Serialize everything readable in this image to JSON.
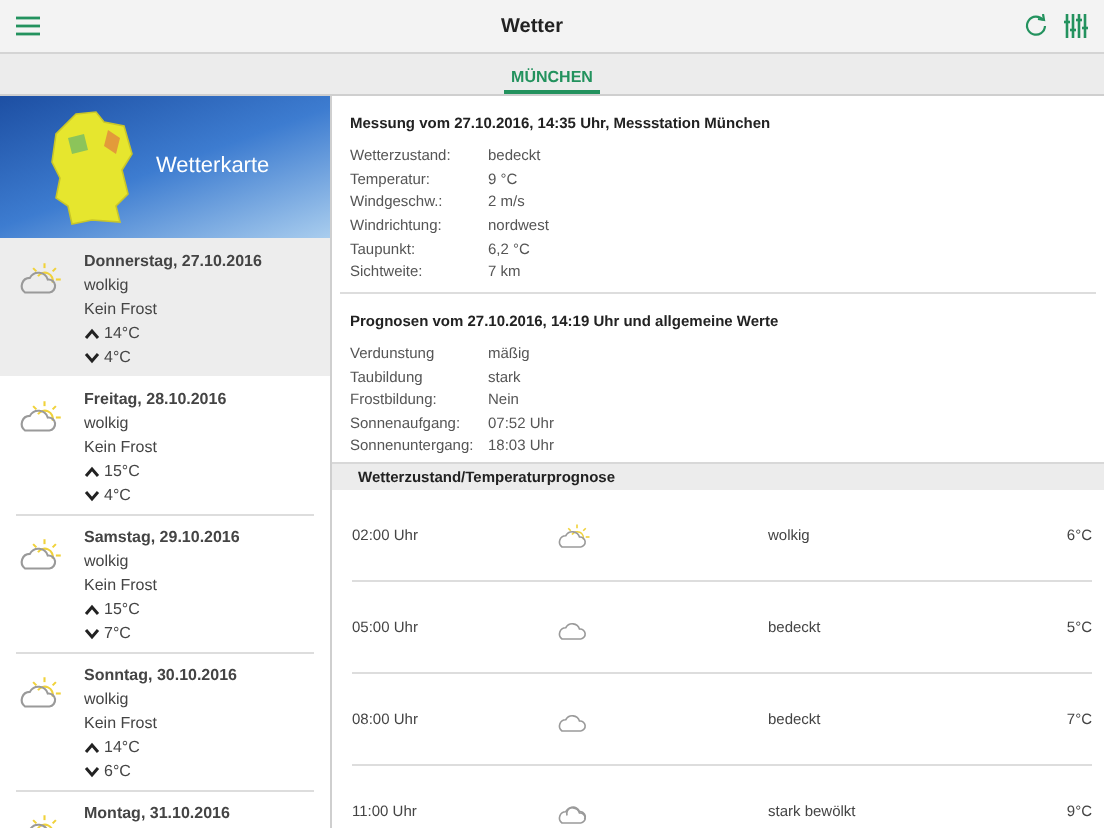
{
  "header": {
    "title": "Wetter"
  },
  "tabs": [
    {
      "label": "MÜNCHEN",
      "selected": true
    }
  ],
  "banner": {
    "label": "Wetterkarte"
  },
  "days": [
    {
      "date": "Donnerstag, 27.10.2016",
      "condition": "wolkig",
      "frost": "Kein Frost",
      "high": "14°C",
      "low": "4°C",
      "selected": true
    },
    {
      "date": "Freitag, 28.10.2016",
      "condition": "wolkig",
      "frost": "Kein Frost",
      "high": "15°C",
      "low": "4°C",
      "selected": false
    },
    {
      "date": "Samstag, 29.10.2016",
      "condition": "wolkig",
      "frost": "Kein Frost",
      "high": "15°C",
      "low": "7°C",
      "selected": false
    },
    {
      "date": "Sonntag, 30.10.2016",
      "condition": "wolkig",
      "frost": "Kein Frost",
      "high": "14°C",
      "low": "6°C",
      "selected": false
    },
    {
      "date": "Montag, 31.10.2016",
      "selected": false
    }
  ],
  "measurement": {
    "title": "Messung vom 27.10.2016, 14:35 Uhr, Messstation München",
    "rows": [
      {
        "label": "Wetterzustand:",
        "value": "bedeckt"
      },
      {
        "label": "Temperatur:",
        "value": "9 °C"
      },
      {
        "label": "Windgeschw.:",
        "value": "2 m/s"
      },
      {
        "label": "Windrichtung:",
        "value": "nordwest"
      },
      {
        "label": "Taupunkt:",
        "value": "6,2 °C"
      },
      {
        "label": "Sichtweite:",
        "value": "7 km"
      }
    ]
  },
  "forecast": {
    "title": "Prognosen vom 27.10.2016, 14:19 Uhr und allgemeine Werte",
    "rows": [
      {
        "label": "Verdunstung",
        "value": "mäßig"
      },
      {
        "label": "Taubildung",
        "value": "stark"
      },
      {
        "label": "Frostbildung:",
        "value": "Nein"
      },
      {
        "label": "Sonnenaufgang:",
        "value": "07:52 Uhr"
      },
      {
        "label": "Sonnenuntergang:",
        "value": "18:03 Uhr"
      }
    ]
  },
  "hourly": {
    "title": "Wetterzustand/Temperaturprognose",
    "rows": [
      {
        "time": "02:00 Uhr",
        "kind": "partly-cloudy",
        "condition": "wolkig",
        "temperature": "6°C"
      },
      {
        "time": "05:00 Uhr",
        "kind": "cloud",
        "condition": "bedeckt",
        "temperature": "5°C"
      },
      {
        "time": "08:00 Uhr",
        "kind": "cloud",
        "condition": "bedeckt",
        "temperature": "7°C"
      },
      {
        "time": "11:00 Uhr",
        "kind": "two-clouds",
        "condition": "stark bewölkt",
        "temperature": "9°C"
      }
    ]
  }
}
